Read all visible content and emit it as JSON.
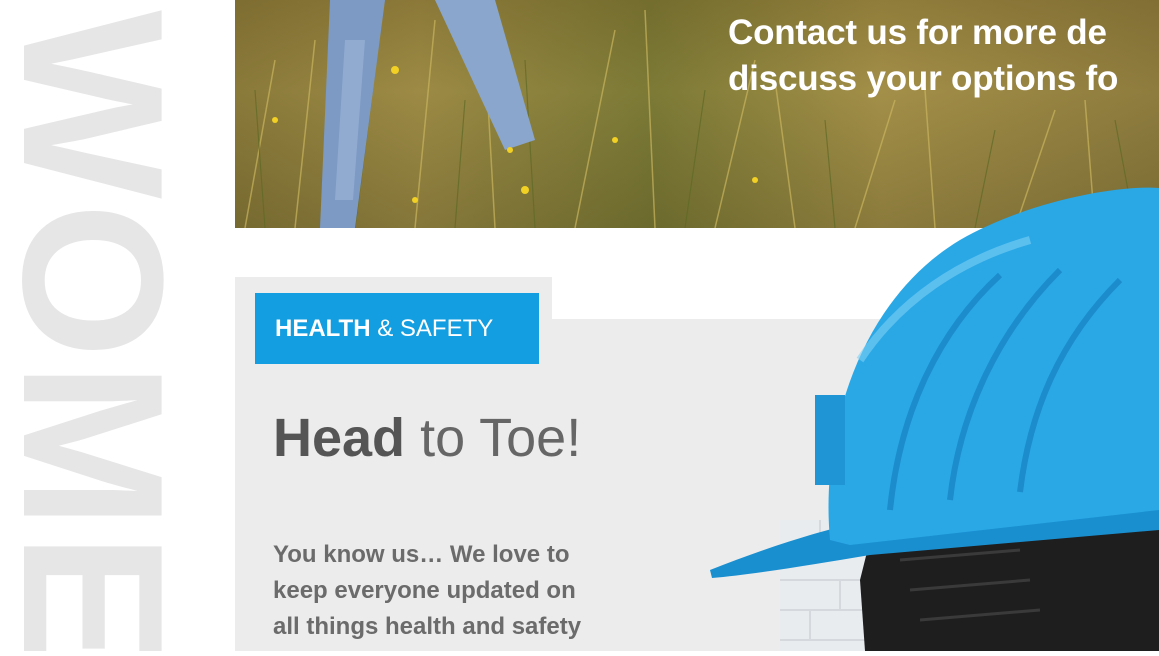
{
  "side_word": "WOMEN",
  "hero": {
    "line1": "Contact us for more de",
    "line2": "discuss your options fo"
  },
  "section": {
    "tag_bold": "HEALTH",
    "tag_rest": "& SAFETY",
    "headline_bold": "Head",
    "headline_rest": "to Toe!",
    "body_line1": "You know us… We love to",
    "body_line2": "keep everyone updated on",
    "body_line3": "all things health and safety"
  },
  "colors": {
    "accent": "#129ee0",
    "helmet": "#2aa8e6",
    "panel": "#ececec"
  },
  "icons": [
    "helmet-image",
    "hero-photo"
  ]
}
